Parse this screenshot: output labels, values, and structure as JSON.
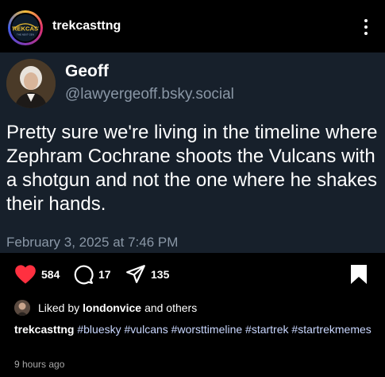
{
  "header": {
    "username": "trekcasttng",
    "logo_text": "TREKCAST",
    "logo_subtext": "THE NEXT GEN"
  },
  "post": {
    "author_name": "Geoff",
    "author_handle": "@lawyergeoff.bsky.social",
    "text": "Pretty sure we're living in the timeline where Zephram Cochrane shoots the Vulcans with a shotgun and not the one where he shakes their hands.",
    "timestamp": "February 3, 2025 at 7:46 PM"
  },
  "actions": {
    "likes": "584",
    "comments": "17",
    "shares": "135"
  },
  "liked_by": {
    "prefix": "Liked by",
    "user": "londonvice",
    "suffix": "and others"
  },
  "caption": {
    "user": "trekcasttng",
    "hashtags": [
      "#bluesky",
      "#vulcans",
      "#worsttimeline",
      "#startrek",
      "#startrekmemes"
    ]
  },
  "time_ago": "9 hours ago",
  "colors": {
    "post_bg": "#17202b",
    "handle_gray": "#8a97a6",
    "like_red": "#ff3040",
    "hashtag_blue": "#c9d7ff"
  }
}
